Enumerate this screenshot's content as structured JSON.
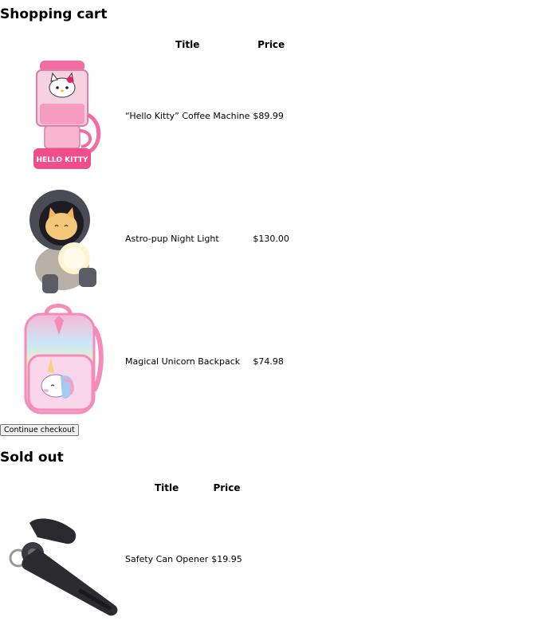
{
  "cart": {
    "heading": "Shopping cart",
    "col_title": "Title",
    "col_price": "Price",
    "items": [
      {
        "title": "“Hello Kitty” Coffee Machine",
        "price": "$89.99",
        "image": "hello-kitty-coffee-machine-image"
      },
      {
        "title": "Astro-pup Night Light",
        "price": "$130.00",
        "image": "astro-pup-night-light-image"
      },
      {
        "title": "Magical Unicorn Backpack",
        "price": "$74.98",
        "image": "unicorn-backpack-image"
      }
    ],
    "checkout_label": "Continue checkout"
  },
  "soldout": {
    "heading": "Sold out",
    "col_title": "Title",
    "col_price": "Price",
    "items": [
      {
        "title": "Safety Can Opener",
        "price": "$19.95",
        "image": "can-opener-image"
      }
    ]
  }
}
